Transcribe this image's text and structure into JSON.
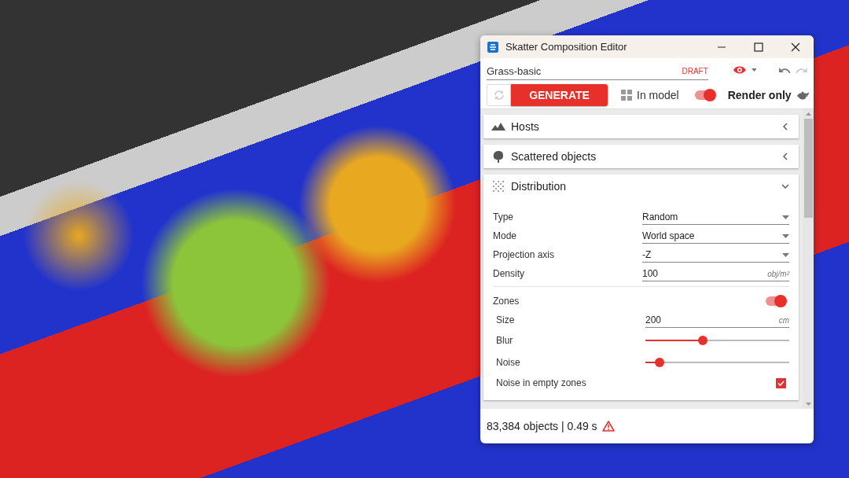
{
  "window": {
    "title": "Skatter Composition Editor"
  },
  "name_field": {
    "value": "Grass-basic",
    "badge": "DRAFT"
  },
  "toolbar": {
    "generate_button": "GENERATE",
    "in_model": {
      "label": "In model"
    },
    "render_toggle": {
      "on": true
    },
    "render_only": "Render only"
  },
  "sections": [
    {
      "title": "Hosts",
      "expanded": false
    },
    {
      "title": "Scattered objects",
      "expanded": false
    },
    {
      "title": "Distribution",
      "expanded": true,
      "fields": [
        {
          "kind": "select",
          "label": "Type",
          "value": "Random"
        },
        {
          "kind": "select",
          "label": "Mode",
          "value": "World space"
        },
        {
          "kind": "select",
          "label": "Projection axis",
          "value": "-Z"
        },
        {
          "kind": "number",
          "label": "Density",
          "value": "100",
          "unit": "obj/m²"
        },
        {
          "kind": "toggle",
          "label": "Zones",
          "on": true,
          "children": [
            {
              "kind": "number",
              "label": "Size",
              "value": "200",
              "unit": "cm"
            },
            {
              "kind": "slider",
              "label": "Blur",
              "level": 0.4
            },
            {
              "kind": "slider",
              "label": "Noise",
              "level": 0.1
            },
            {
              "kind": "checkbox",
              "label": "Noise in empty zones",
              "checked": true
            }
          ]
        }
      ]
    }
  ],
  "status_bar": {
    "text": "83,384 objects | 0.49 s",
    "warning": true
  }
}
